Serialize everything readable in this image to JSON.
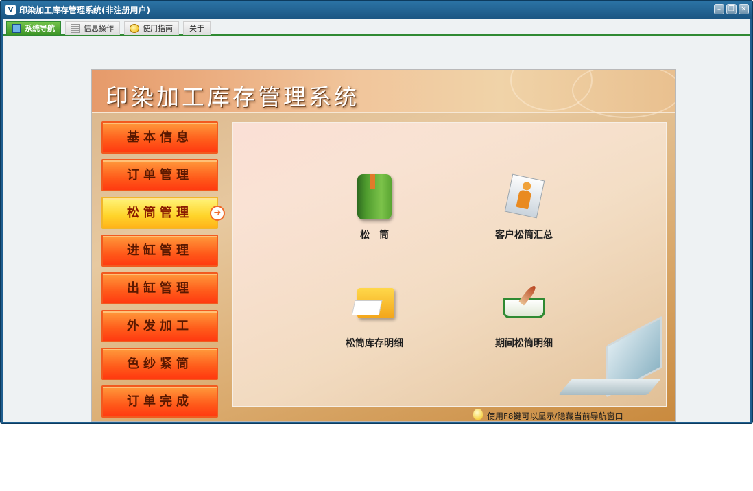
{
  "window": {
    "title": "印染加工库存管理系统(非注册用户)",
    "app_icon_glyph": "V",
    "controls": {
      "minimize": "–",
      "restore": "❐",
      "close": "✕"
    }
  },
  "tabs": [
    {
      "label": "系统导航",
      "icon": "monitor-icon",
      "active": true
    },
    {
      "label": "信息操作",
      "icon": "grid-icon",
      "active": false
    },
    {
      "label": "使用指南",
      "icon": "bulb-icon",
      "active": false
    },
    {
      "label": "关于",
      "icon": "",
      "active": false
    }
  ],
  "banner": {
    "title": "印染加工库存管理系统"
  },
  "menu": [
    {
      "label": "基本信息"
    },
    {
      "label": "订单管理"
    },
    {
      "label": "松筒管理",
      "active": true,
      "arrow": "➜"
    },
    {
      "label": "进缸管理"
    },
    {
      "label": "出缸管理"
    },
    {
      "label": "外发加工"
    },
    {
      "label": "色纱紧筒"
    },
    {
      "label": "订单完成"
    }
  ],
  "content": {
    "tiles": [
      {
        "label": "松　筒",
        "icon": "green-book-icon"
      },
      {
        "label": "客户松筒汇总",
        "icon": "person-document-icon"
      },
      {
        "label": "松筒库存明细",
        "icon": "folder-pen-icon"
      },
      {
        "label": "期间松筒明细",
        "icon": "open-book-quill-icon"
      }
    ]
  },
  "hint": {
    "text": "使用F8键可以显示/隐藏当前导航窗口"
  },
  "colors": {
    "accent": "#2f8a32",
    "title_bar": "#1f5f8f",
    "menu_button": "#ff5a1a",
    "menu_active": "#ffd42a"
  }
}
